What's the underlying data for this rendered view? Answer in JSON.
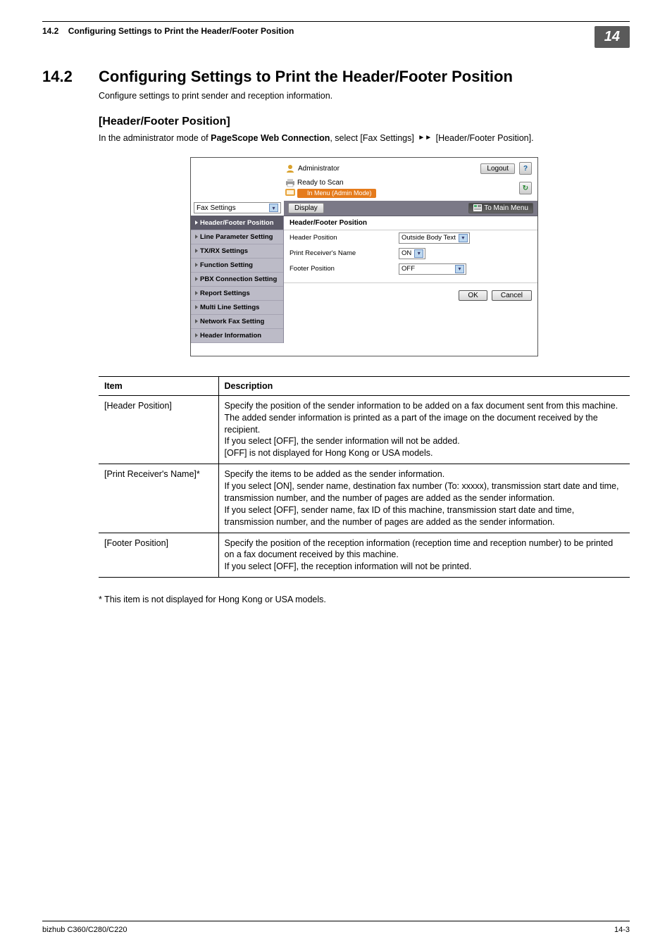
{
  "header": {
    "section_number": "14.2",
    "section_title": "Configuring Settings to Print the Header/Footer Position",
    "chapter_number": "14"
  },
  "main": {
    "heading_number": "14.2",
    "heading_title": "Configuring Settings to Print the Header/Footer Position",
    "intro": "Configure settings to print sender and reception information.",
    "sub_heading": "[Header/Footer Position]",
    "instruction_pre": "In the administrator mode of ",
    "instruction_bold": "PageScope Web Connection",
    "instruction_mid1": ", select [Fax Settings] ",
    "instruction_mid2": " [Header/Footer Position].",
    "footnote": "* This item is not displayed for Hong Kong or USA models."
  },
  "screenshot": {
    "admin_label": "Administrator",
    "logout": "Logout",
    "help_symbol": "?",
    "status_ready": "Ready to Scan",
    "status_mode": "In Menu (Admin Mode)",
    "refresh_symbol": "↻",
    "dropdown": "Fax Settings",
    "display_btn": "Display",
    "to_main_menu": "To Main Menu",
    "side_items": [
      "Header/Footer Position",
      "Line Parameter Setting",
      "TX/RX Settings",
      "Function Setting",
      "PBX Connection Setting",
      "Report Settings",
      "Multi Line Settings",
      "Network Fax Setting",
      "Header Information"
    ],
    "content": {
      "title": "Header/Footer Position",
      "rows": [
        {
          "label": "Header Position",
          "value": "Outside Body Text"
        },
        {
          "label": "Print Receiver's Name",
          "value": "ON"
        },
        {
          "label": "Footer Position",
          "value": "OFF"
        }
      ],
      "ok": "OK",
      "cancel": "Cancel"
    }
  },
  "table": {
    "head_item": "Item",
    "head_desc": "Description",
    "rows": [
      {
        "item": "[Header Position]",
        "desc": "Specify the position of the sender information to be added on a fax document sent from this machine. The added sender information is printed as a part of the image on the document received by the recipient.\nIf you select [OFF], the sender information will not be added.\n[OFF] is not displayed for Hong Kong or USA models."
      },
      {
        "item": "[Print Receiver's Name]*",
        "desc": "Specify the items to be added as the sender information.\nIf you select [ON], sender name, destination fax number (To: xxxxx), transmission start date and time, transmission number, and the number of pages are added as the sender information.\nIf you select [OFF], sender name, fax ID of this machine, transmission start date and time, transmission number, and the number of pages are added as the sender information."
      },
      {
        "item": "[Footer Position]",
        "desc": "Specify the position of the reception information (reception time and reception number) to be printed on a fax document received by this machine.\nIf you select [OFF], the reception information will not be printed."
      }
    ]
  },
  "footer": {
    "product": "bizhub C360/C280/C220",
    "page": "14-3"
  }
}
